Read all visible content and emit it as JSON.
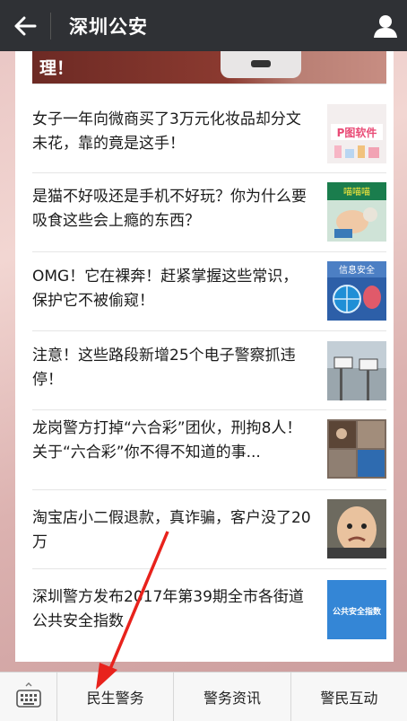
{
  "header": {
    "title": "深圳公安",
    "back_icon": "arrow-left-icon",
    "profile_icon": "person-icon"
  },
  "cover": {
    "text": "理！"
  },
  "news": [
    {
      "title": "女子一年向微商买了3万元化妆品却分文未花，靠的竟是这手！",
      "thumb_caption": "P图软件"
    },
    {
      "title": "是猫不好吸还是手机不好玩？你为什么要吸食这些会上瘾的东西？",
      "thumb_caption": "喵喵喵"
    },
    {
      "title": "OMG！它在裸奔！赶紧掌握这些常识，保护它不被偷窥！",
      "thumb_caption": "信息安全"
    },
    {
      "title": "注意！这些路段新增25个电子警察抓违停！",
      "thumb_caption": ""
    },
    {
      "title": "龙岗警方打掉“六合彩”团伙，刑拘8人！关于“六合彩”你不得不知道的事...",
      "thumb_caption": ""
    },
    {
      "title": "淘宝店小二假退款，真诈骗，客户没了20万",
      "thumb_caption": ""
    },
    {
      "title": "深圳警方发布2017年第39期全市各街道公共安全指数",
      "thumb_caption": "公共安全指数"
    }
  ],
  "menu": {
    "keyboard_icon": "keyboard-icon",
    "items": [
      "民生警务",
      "警务资讯",
      "警民互动"
    ]
  },
  "colors": {
    "topbar": "#2f3135",
    "arrow": "#e8221c"
  }
}
